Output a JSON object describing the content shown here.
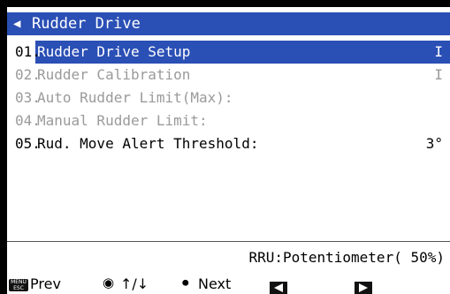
{
  "header": {
    "back_icon": "left-triangle-icon",
    "title": "Rudder Drive"
  },
  "menu": [
    {
      "number": "01.",
      "label": "Rudder Drive Setup",
      "value": "I",
      "state": "selected"
    },
    {
      "number": "02.",
      "label": "Rudder Calibration",
      "value": "I",
      "state": "disabled"
    },
    {
      "number": "03.",
      "label": "Auto Rudder Limit(Max):",
      "value": "",
      "state": "disabled"
    },
    {
      "number": "04.",
      "label": "Manual Rudder Limit:",
      "value": "",
      "state": "disabled"
    },
    {
      "number": "05.",
      "label": "Rud. Move Alert Threshold:",
      "value": "3°",
      "state": "enabled"
    }
  ],
  "status": {
    "text": "RRU:Potentiometer( 50%)"
  },
  "footer": {
    "menu_key_text": "MENU\nESC",
    "prev_label": "Prev",
    "updown_label": "↑/↓",
    "next_label": "Next"
  },
  "colors": {
    "highlight": "#2a4fb5",
    "disabled_text": "#9a9a9a"
  }
}
